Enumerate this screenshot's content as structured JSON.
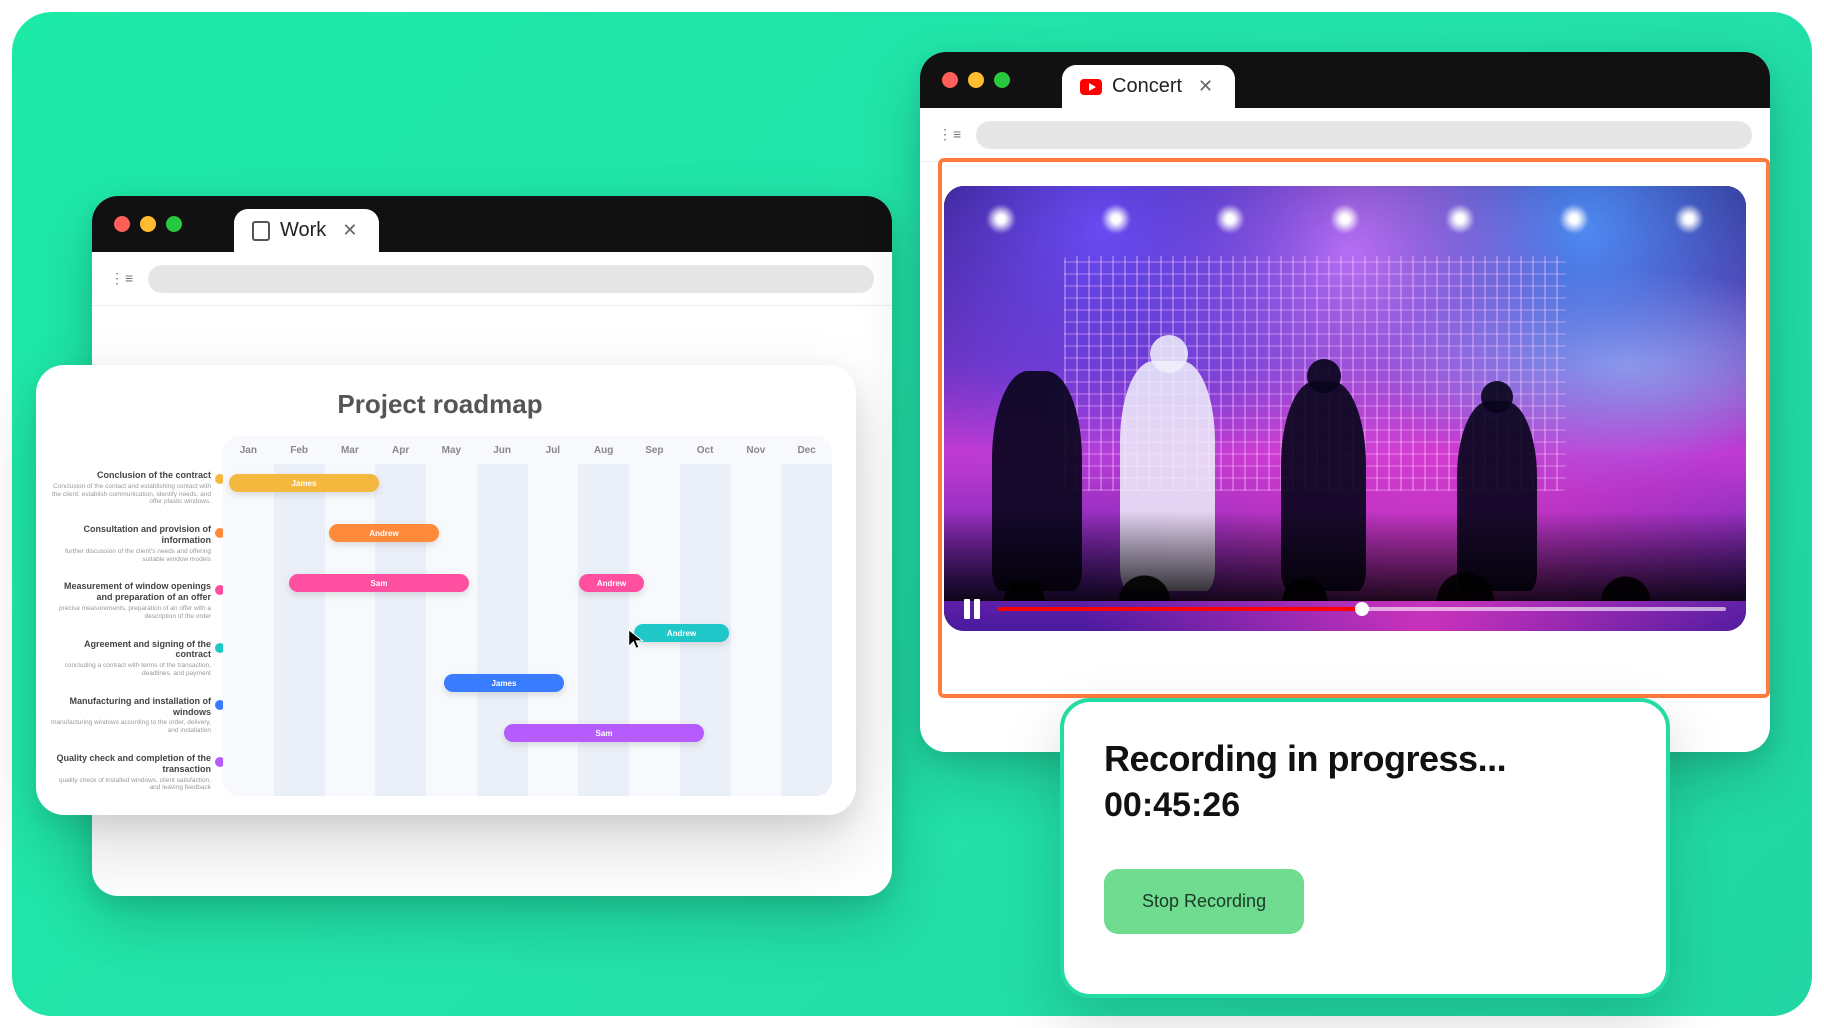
{
  "workWindow": {
    "tabLabel": "Work"
  },
  "concertWindow": {
    "tabLabel": "Concert"
  },
  "roadmap": {
    "title": "Project roadmap",
    "months": [
      "Jan",
      "Feb",
      "Mar",
      "Apr",
      "May",
      "Jun",
      "Jul",
      "Aug",
      "Sep",
      "Oct",
      "Nov",
      "Dec"
    ],
    "tasks": [
      {
        "title": "Conclusion of the contract",
        "desc": "Conclusion of the contact and establishing contact with the client: establish communication, identify needs, and offer plastic windows.",
        "color": "#f4b83f"
      },
      {
        "title": "Consultation and provision of information",
        "desc": "further discussion of the client's needs and offering suitable window models",
        "color": "#ff8a3c"
      },
      {
        "title": "Measurement of window openings and preparation of an offer",
        "desc": "precise measurements, preparation of an offer with a description of the order",
        "color": "#ff4fa0"
      },
      {
        "title": "Agreement and signing of the contract",
        "desc": "concluding a contract with terms of the transaction, deadlines, and payment",
        "color": "#1fc7c9"
      },
      {
        "title": "Manufacturing and installation of windows",
        "desc": "manufacturing windows according to the order, delivery, and installation",
        "color": "#3a7cff"
      },
      {
        "title": "Quality check and completion of the transaction",
        "desc": "quality check of installed windows, client satisfaction, and leaving feedback",
        "color": "#b65cff"
      }
    ],
    "bars": [
      {
        "label": "James",
        "row": 0,
        "start": 0,
        "span": 3,
        "color": "#f4b83f"
      },
      {
        "label": "Andrew",
        "row": 1,
        "start": 2,
        "span": 2.2,
        "color": "#ff8a3c"
      },
      {
        "label": "Sam",
        "row": 2,
        "start": 1.2,
        "span": 3.6,
        "color": "#ff4fa0"
      },
      {
        "label": "Andrew",
        "row": 2,
        "start": 7,
        "span": 1.3,
        "color": "#ff4fa0"
      },
      {
        "label": "Andrew",
        "row": 3,
        "start": 8.1,
        "span": 1.9,
        "color": "#1fc7c9"
      },
      {
        "label": "James",
        "row": 4,
        "start": 4.3,
        "span": 2.4,
        "color": "#3a7cff"
      },
      {
        "label": "Sam",
        "row": 5,
        "start": 5.5,
        "span": 4,
        "color": "#b65cff"
      }
    ]
  },
  "video": {
    "progressPct": 50
  },
  "recording": {
    "title": "Recording in progress...",
    "time": "00:45:26",
    "stopLabel": "Stop Recording"
  }
}
